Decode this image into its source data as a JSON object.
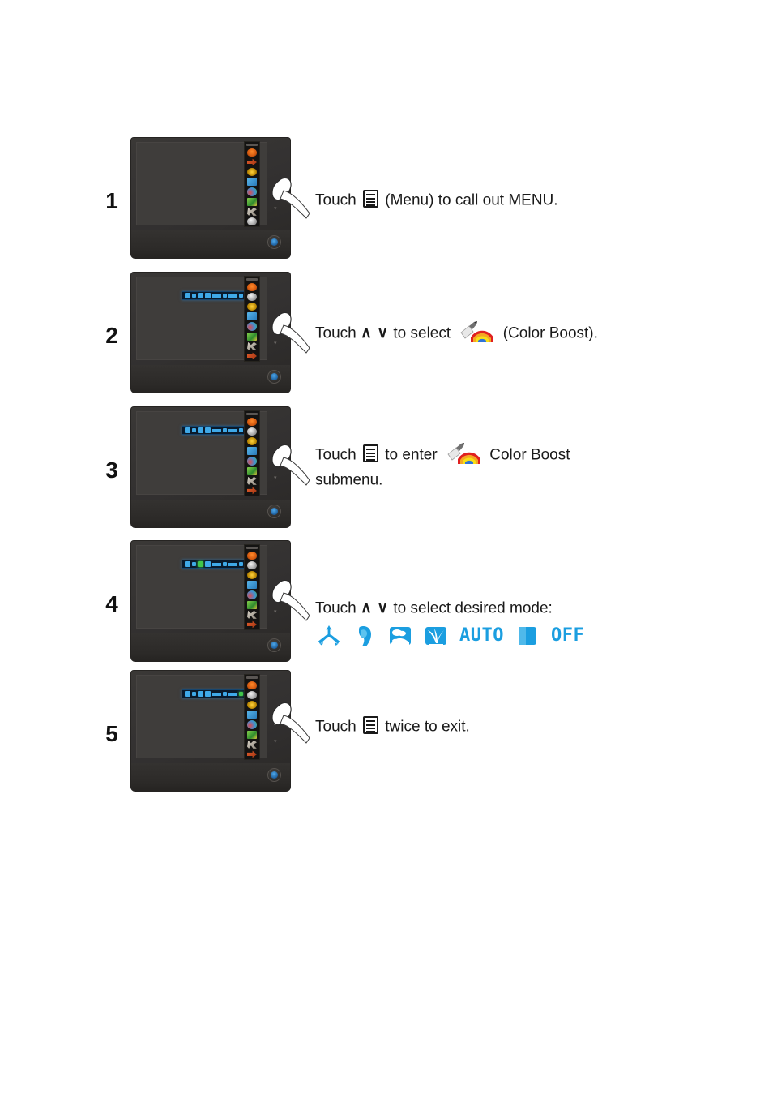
{
  "document": {
    "title": "Color Boost OSD Setup Steps",
    "accent_blue": "#1b9ee0",
    "monitor_body_color": "#2b2927",
    "screen_color": "#3f3d3b"
  },
  "steps": [
    {
      "number": "1",
      "monitor_state": "menu-closed",
      "text_lines": [
        {
          "segments": [
            {
              "type": "text",
              "value": "Touch "
            },
            {
              "type": "icon",
              "name": "menu-icon"
            },
            {
              "type": "text",
              "value": " (Menu) to  call out MENU."
            }
          ]
        }
      ]
    },
    {
      "number": "2",
      "monitor_state": "menu-open-submenu-bar",
      "text_lines": [
        {
          "segments": [
            {
              "type": "text",
              "value": "Touch "
            },
            {
              "type": "caret",
              "value": "∧"
            },
            {
              "type": "text",
              "value": " "
            },
            {
              "type": "caret",
              "value": "∨"
            },
            {
              "type": "text",
              "value": " to select "
            },
            {
              "type": "icon",
              "name": "color-boost-icon"
            },
            {
              "type": "text",
              "value": " (Color Boost)."
            }
          ]
        }
      ]
    },
    {
      "number": "3",
      "monitor_state": "menu-open-submenu-bar",
      "text_lines": [
        {
          "segments": [
            {
              "type": "text",
              "value": "Touch "
            },
            {
              "type": "icon",
              "name": "menu-icon"
            },
            {
              "type": "text",
              "value": " to enter "
            },
            {
              "type": "icon",
              "name": "color-boost-icon"
            },
            {
              "type": "text",
              "value": " Color Boost"
            }
          ]
        },
        {
          "segments": [
            {
              "type": "text",
              "value": "submenu."
            }
          ]
        }
      ]
    },
    {
      "number": "4",
      "monitor_state": "menu-open-item-highlighted",
      "text_lines": [
        {
          "segments": [
            {
              "type": "text",
              "value": "Touch  "
            },
            {
              "type": "caret",
              "value": "∧"
            },
            {
              "type": "text",
              "value": " "
            },
            {
              "type": "caret",
              "value": "∨"
            },
            {
              "type": "text",
              "value": " to select desired  mode:"
            }
          ]
        }
      ]
    },
    {
      "number": "5",
      "monitor_state": "menu-open-submenu-bar",
      "text_lines": [
        {
          "segments": [
            {
              "type": "text",
              "value": "Touch "
            },
            {
              "type": "icon",
              "name": "menu-icon"
            },
            {
              "type": "text",
              "value": " twice to exit."
            }
          ]
        }
      ]
    }
  ],
  "color_boost_modes": [
    {
      "name": "full-enhance-icon",
      "label": "",
      "type": "icon"
    },
    {
      "name": "nature-skin-icon",
      "label": "",
      "type": "icon"
    },
    {
      "name": "green-field-icon",
      "label": "",
      "type": "icon"
    },
    {
      "name": "sky-blue-icon",
      "label": "",
      "type": "icon"
    },
    {
      "name": "auto-detect-label",
      "label": "AUTO",
      "type": "word"
    },
    {
      "name": "color-bar-icon",
      "label": "",
      "type": "icon"
    },
    {
      "name": "off-label",
      "label": "OFF",
      "type": "word"
    }
  ],
  "osd_sidebar_icons": [
    "luminance-icon",
    "selected-item-icon",
    "color-setup-icon",
    "image-setup-icon",
    "color-boost-icon",
    "picture-boost-icon",
    "osd-setup-icon",
    "extra-icon",
    "exit-icon"
  ],
  "osd_submenu_items": [
    "full-enhance-icon",
    "nature-skin-icon",
    "green-field-icon",
    "sky-blue-icon",
    "auto-detect-icon",
    "color-bar-icon",
    "off-icon",
    "exit-icon"
  ],
  "monitor_controls": {
    "up_arrow": "▴",
    "down_arrow": "▾",
    "power_button": "power-button"
  }
}
